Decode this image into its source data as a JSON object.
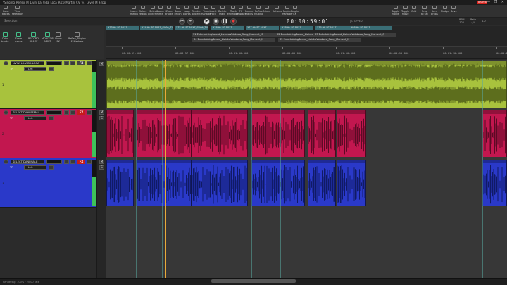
{
  "window": {
    "title": "*Singing_Reflex_M_Livin_La_Vida_Loca_RickyMartin_CV_v4_Level_M_F.rpp",
    "badge": "REAPER"
  },
  "toolbar": {
    "left": [
      {
        "label": "Color",
        "sub": "tracks"
      },
      {
        "label": "Time",
        "sub": "selection"
      }
    ],
    "center": [
      {
        "label": "Insert",
        "sub": "media"
      },
      {
        "label": "Select",
        "sub": "region"
      },
      {
        "label": "Select",
        "sub": "all items"
      },
      {
        "label": "Zoom",
        "sub": "time"
      },
      {
        "label": "Zoom",
        "sub": "tracks"
      },
      {
        "label": "Snap",
        "sub": "off/on"
      },
      {
        "label": "Loop",
        "sub": "points"
      },
      {
        "label": "Render",
        "sub": "project"
      },
      {
        "label": "Track",
        "sub": "manager"
      },
      {
        "label": "Insert",
        "sub": "track"
      },
      {
        "label": "Delete",
        "sub": "track"
      },
      {
        "label": "Track",
        "sub": "envelopes"
      },
      {
        "label": "FX",
        "sub": "browser"
      }
    ],
    "mid": [
      {
        "label": "Freeze",
        "sub": "tracks"
      },
      {
        "label": "Reflex",
        "sub": "routing"
      },
      {
        "label": "Mixer",
        "sub": ""
      },
      {
        "label": "Actions",
        "sub": ""
      },
      {
        "label": "Region",
        "sub": "manager"
      },
      {
        "label": "Toggle",
        "sub": "FX"
      }
    ],
    "right": [
      {
        "label": "Toggle",
        "sub": "ripple"
      },
      {
        "label": "Toggle",
        "sub": "move"
      },
      {
        "label": "Grid",
        "sub": ""
      },
      {
        "label": "Crop",
        "sub": "to sel"
      },
      {
        "label": "Item",
        "sub": "props"
      },
      {
        "label": "Nudge",
        "sub": ""
      },
      {
        "label": "Save",
        "sub": ""
      }
    ]
  },
  "transport": {
    "selection_label": "Selection",
    "timecode": "00:00:59:01",
    "status": "[STOPPED]",
    "bpm_label": "BPM",
    "bpm_value": "120",
    "time_sig": "4/4",
    "rate_label": "Rate",
    "rate_value": "1.0"
  },
  "tcp_toolbar": [
    {
      "label": "Color",
      "sub": "tracks",
      "green": true
    },
    {
      "label": "Scale",
      "sub": "tracks",
      "green": true
    },
    {
      "label": "RECORD",
      "sub": "READY",
      "green": true
    },
    {
      "label": "MONITOR",
      "sub": "INPUT",
      "green": true
    },
    {
      "label": "Show",
      "sub": "FX",
      "green": false
    },
    {
      "label": "Reflex_Plugins",
      "sub": "& Markers",
      "green": false
    }
  ],
  "regions_row1": [
    "173 AL SP 1017",
    "174 AL SP 1007_CHAL_THEM 1017 1",
    "172 AL SP 1017_CHAL_THEM 1017 1",
    "176 AL SP 1017",
    "177 AL SP 1017",
    "178 AL SP 1017",
    "179 AL SP 1017",
    "180 AL SP 1017"
  ],
  "regions_row2": [
    "31 EntertainingSound_LivinLaVidaLoca_Song_Moment_M",
    "32 EntertainingSound_LivinLaVidaLoca_Song_Moment_M",
    "33 EntertainingSound_LivinLaVidaLoca_Song_Moment_Q",
    "34 EntertainingSound_LivinLaVidaLoca_Song_Moment_N",
    "35 EntertainingSound_LivinLaVidaLoca_Song_Moment_N"
  ],
  "ruler": {
    "top": [
      "00:00:55.000",
      "00:00:56.000",
      "00:00:57.000",
      "00:00:58.000",
      "00:00:59.000",
      "00:01:00.000",
      "00:01:01.000"
    ],
    "bottom": [
      "00:00:55.000",
      "00:00:57.000",
      "00:01:00.000",
      "00:01:05.000",
      "00:01:10.000",
      "00:01:15.000",
      "00:01:20.000",
      "00:01:25.000"
    ]
  },
  "master": {
    "m": "M",
    "s": "S"
  },
  "tracks": [
    {
      "num": "1",
      "name": "LIVIN' LA VIDA LOCA",
      "fx": "FX",
      "pan": "Left",
      "trim": "TR",
      "color": "#a8c23d",
      "wave": "#5d6e1d",
      "meter": 0.78
    },
    {
      "num": "2",
      "name": "SELECT DANI FEMAL",
      "fx": "FX",
      "pan": "Left",
      "trim": "TR",
      "color": "#c2174f",
      "wave": "#5c0a25",
      "meter": 0.55
    },
    {
      "num": "3",
      "name": "SELECT DANI MALE",
      "fx": "FX",
      "pan": "Left",
      "trim": "TR",
      "color": "#2a39c9",
      "wave": "#101a66",
      "meter": 0.62
    }
  ],
  "status_bar": "Rendering: 100% / 25:00 rate"
}
